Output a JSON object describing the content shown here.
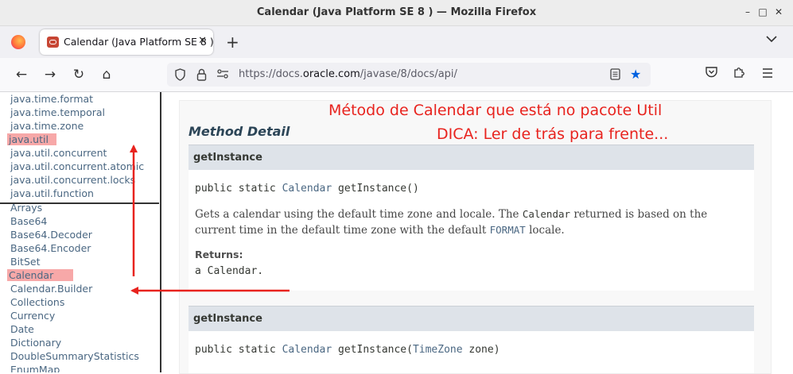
{
  "window": {
    "title": "Calendar (Java Platform SE 8 ) — Mozilla Firefox",
    "minimize": "–",
    "maximize": "□",
    "close": "✕"
  },
  "tab": {
    "label": "Calendar (Java Platform SE 8 )",
    "close": "✕",
    "new_tab": "+",
    "list_all": "⌵"
  },
  "nav": {
    "back": "←",
    "forward": "→",
    "reload": "↻",
    "home": "⌂",
    "url_prefix": "https://docs.",
    "url_domain": "oracle.com",
    "url_suffix": "/javase/8/docs/api/"
  },
  "packages": [
    "java.time.format",
    "java.time.temporal",
    "java.time.zone",
    "java.util",
    "java.util.concurrent",
    "java.util.concurrent.atomic",
    "java.util.concurrent.locks",
    "java.util.function"
  ],
  "highlighted_package": "java.util",
  "classes": [
    "Arrays",
    "Base64",
    "Base64.Decoder",
    "Base64.Encoder",
    "BitSet",
    "Calendar",
    "Calendar.Builder",
    "Collections",
    "Currency",
    "Date",
    "Dictionary",
    "DoubleSummaryStatistics",
    "EnumMap"
  ],
  "highlighted_class": "Calendar",
  "detail": {
    "heading": "Method Detail",
    "method1": {
      "name": "getInstance",
      "sig_pre": "public static ",
      "sig_type": "Calendar",
      "sig_post": " getInstance()",
      "desc_1": "Gets a calendar using the default time zone and locale. The ",
      "desc_code1": "Calendar",
      "desc_2": " returned is based on the current time in the default time zone with the default ",
      "desc_code2": "FORMAT",
      "desc_3": " locale.",
      "returns_label": "Returns:",
      "returns_value": "a Calendar."
    },
    "method2": {
      "name": "getInstance",
      "sig_pre": "public static ",
      "sig_type": "Calendar",
      "sig_mid": " getInstance(",
      "sig_param_type": "TimeZone",
      "sig_post": " zone)"
    }
  },
  "annotations": {
    "line1": "Método de Calendar que está no pacote Util",
    "line2": "DICA: Ler de trás para frente...",
    "color": "#e8231e"
  }
}
